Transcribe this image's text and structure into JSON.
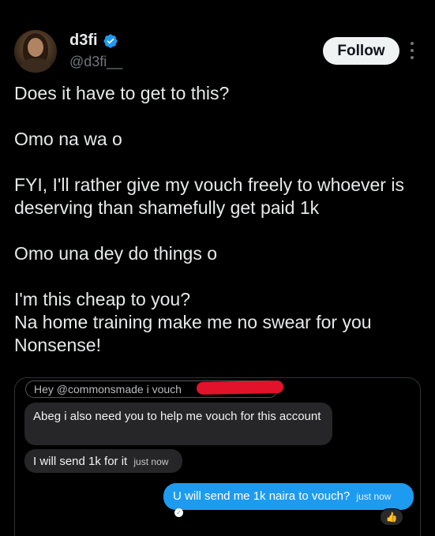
{
  "author": {
    "display_name": "d3fi",
    "handle": "@d3fi__",
    "verified_icon": "verified-badge-icon",
    "verified_color": "#1d9bf0"
  },
  "follow_label": "Follow",
  "tweet": {
    "lines": [
      "Does it have to get to this?",
      "Omo na wa o",
      "FYI, I'll rather give my vouch freely to whoever is deserving than shamefully get paid 1k",
      "Omo una dey do things o",
      "I'm this cheap to you?",
      "Na home training make me no swear for you",
      "Nonsense!"
    ]
  },
  "screenshot": {
    "reply_quote": "Hey @commonsmade i vouch",
    "messages": [
      {
        "text": "Abeg i also need you to help me vouch for this account",
        "time": ""
      },
      {
        "text": "I will send 1k for it",
        "time": "just now"
      },
      {
        "text": "U will send me 1k naira to vouch?",
        "time": "just now"
      }
    ],
    "reaction_icon": "thumbs-up-icon",
    "accent": "#1d9bf0"
  }
}
